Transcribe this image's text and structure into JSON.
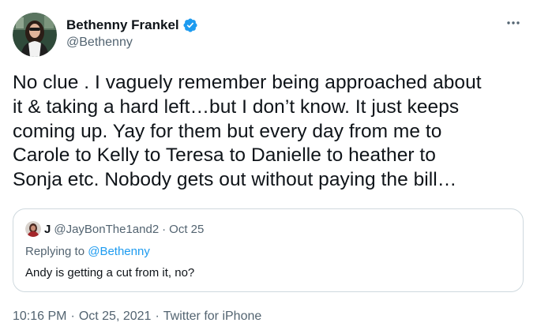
{
  "author": {
    "display_name": "Bethenny Frankel",
    "handle": "@Bethenny",
    "verified": true
  },
  "more_icon": "more-horizontal-icon",
  "tweet": {
    "lines": [
      "No clue . I vaguely remember being approached about",
      "it & taking a hard left…but I don’t know. It just keeps",
      "coming up. Yay for them but every day from me to",
      "Carole to Kelly to Teresa to Danielle to heather to",
      "Sonja etc.  Nobody gets out without paying the bill…"
    ]
  },
  "quote": {
    "name": "J",
    "handle": "@JayBonThe1and2",
    "separator": "·",
    "date": "Oct 25",
    "replying_prefix": "Replying to",
    "replying_handle": "@Bethenny",
    "text": "Andy is getting a cut from it, no?"
  },
  "footer": {
    "time": "10:16 PM",
    "separator1": "·",
    "date": "Oct 25, 2021",
    "separator2": "·",
    "source": "Twitter for iPhone"
  },
  "colors": {
    "text": "#0f1419",
    "secondary": "#536471",
    "link": "#1d9bf0",
    "verified": "#1d9bf0",
    "border": "#cfd9de"
  }
}
